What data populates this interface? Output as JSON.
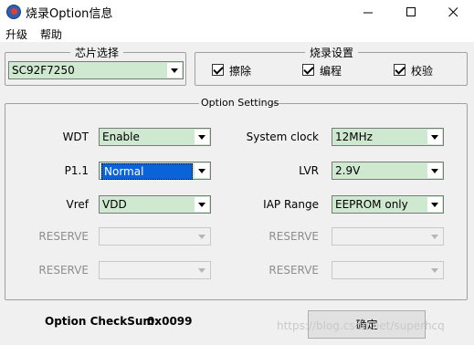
{
  "window": {
    "title": "烧录Option信息"
  },
  "menu": {
    "items": [
      "升级",
      "帮助"
    ]
  },
  "chip_group": {
    "legend": "芯片选择",
    "selected": "SC92F7250"
  },
  "burn_group": {
    "legend": "烧录设置",
    "options": [
      {
        "label": "擦除",
        "checked": true
      },
      {
        "label": "编程",
        "checked": true
      },
      {
        "label": "校验",
        "checked": true
      }
    ]
  },
  "option_group": {
    "legend": "Option Settings",
    "left": [
      {
        "label": "WDT",
        "value": "Enable",
        "enabled": true,
        "selected": false
      },
      {
        "label": "P1.1",
        "value": "Normal",
        "enabled": true,
        "selected": true
      },
      {
        "label": "Vref",
        "value": "VDD",
        "enabled": true,
        "selected": false
      },
      {
        "label": "RESERVE",
        "value": "",
        "enabled": false,
        "selected": false
      },
      {
        "label": "RESERVE",
        "value": "",
        "enabled": false,
        "selected": false
      }
    ],
    "right": [
      {
        "label": "System clock",
        "value": "12MHz",
        "enabled": true,
        "selected": false
      },
      {
        "label": "LVR",
        "value": "2.9V",
        "enabled": true,
        "selected": false
      },
      {
        "label": "IAP Range",
        "value": "EEPROM only",
        "enabled": true,
        "selected": false
      },
      {
        "label": "RESERVE",
        "value": "",
        "enabled": false,
        "selected": false
      },
      {
        "label": "RESERVE",
        "value": "",
        "enabled": false,
        "selected": false
      }
    ]
  },
  "checksum": {
    "label": "Option CheckSum:",
    "value": "0x0099"
  },
  "confirm_button": {
    "label": "确定"
  },
  "watermark": "https://blog.csdn.net/superhcq",
  "colors": {
    "combo_bg": "#cfe8d0",
    "selection": "#0a64d8",
    "window_bg": "#f0f0f0"
  }
}
